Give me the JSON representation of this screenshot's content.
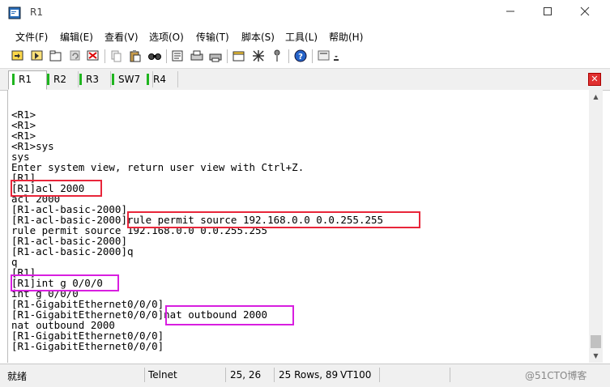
{
  "window": {
    "title": "R1",
    "min_icon": "minimize-icon",
    "max_icon": "maximize-icon",
    "close_icon": "close-icon"
  },
  "menu": [
    "文件(F)",
    "编辑(E)",
    "查看(V)",
    "选项(O)",
    "传输(T)",
    "脚本(S)",
    "工具(L)",
    "帮助(H)"
  ],
  "toolbar_icons": [
    "connect-icon",
    "quick-connect-icon",
    "connect-tab-icon",
    "reconnect-icon",
    "disconnect-icon",
    "copy-icon",
    "paste-icon",
    "find-icon",
    "print-setup-icon",
    "print-icon",
    "properties-icon",
    "settings-icon",
    "keymap-icon",
    "help-icon",
    "session-manager-icon"
  ],
  "tabs": [
    {
      "label": "R1",
      "active": true
    },
    {
      "label": "R2",
      "active": false
    },
    {
      "label": "R3",
      "active": false
    },
    {
      "label": "SW7",
      "active": false
    },
    {
      "label": "R4",
      "active": false
    }
  ],
  "tab_close_label": "✕",
  "terminal": {
    "lines": [
      "<R1>",
      "<R1>",
      "<R1>",
      "<R1>sys",
      "sys",
      "Enter system view, return user view with Ctrl+Z.",
      "[R1]",
      "[R1]acl 2000",
      "acl 2000",
      "[R1-acl-basic-2000]",
      "[R1-acl-basic-2000]rule permit source 192.168.0.0 0.0.255.255",
      "rule permit source 192.168.0.0 0.0.255.255",
      "[R1-acl-basic-2000]",
      "[R1-acl-basic-2000]q",
      "q",
      "[R1]",
      "[R1]int g 0/0/0",
      "int g 0/0/0",
      "[R1-GigabitEthernet0/0/0]",
      "[R1-GigabitEthernet0/0/0]nat outbound 2000",
      "nat outbound 2000",
      "[R1-GigabitEthernet0/0/0]",
      "[R1-GigabitEthernet0/0/0]"
    ],
    "highlight_colors": {
      "red": "#e8263a",
      "magenta": "#d81ee0"
    }
  },
  "status": {
    "ready": "就绪",
    "protocol": "Telnet",
    "cursor": "25,  26",
    "rows": "25 Rows,  89",
    "emulation": "VT100",
    "watermark": "@51CTO博客"
  }
}
